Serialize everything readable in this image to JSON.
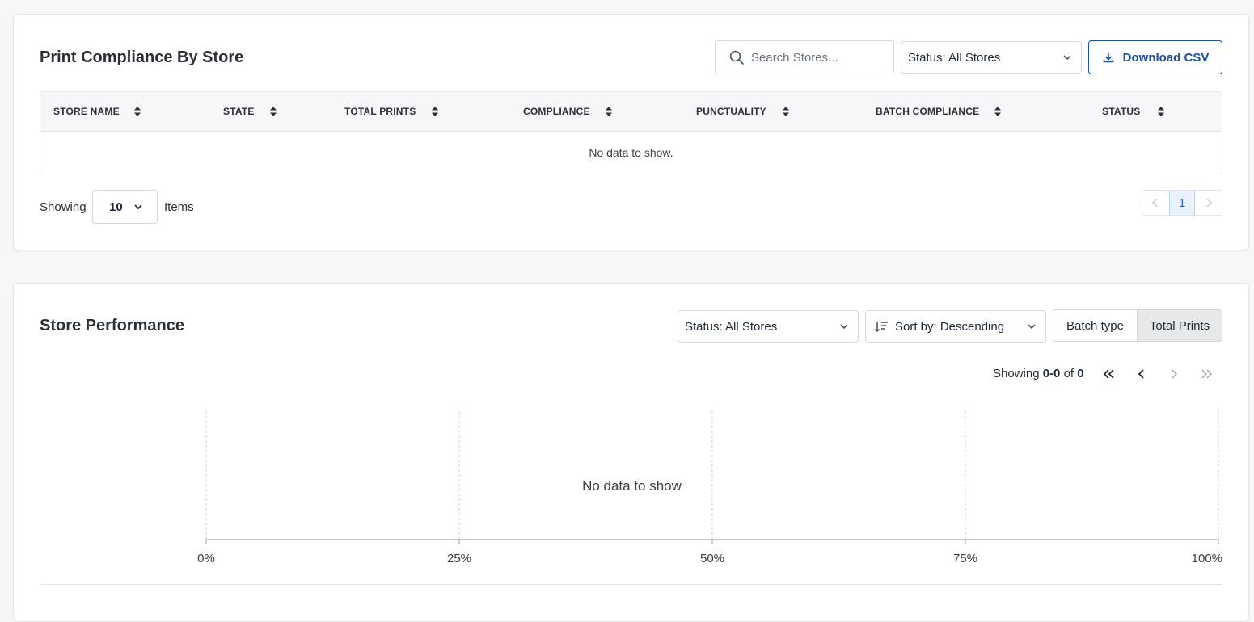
{
  "compliance": {
    "title": "Print Compliance By Store",
    "search_placeholder": "Search Stores...",
    "status_filter": "Status: All Stores",
    "download_label": "Download CSV",
    "columns": [
      "STORE NAME",
      "STATE",
      "TOTAL PRINTS",
      "COMPLIANCE",
      "PUNCTUALITY",
      "BATCH COMPLIANCE",
      "STATUS"
    ],
    "rows": [],
    "empty_text": "No data to show.",
    "showing_label": "Showing",
    "page_size": "10",
    "items_label": "Items",
    "current_page": "1"
  },
  "performance": {
    "title": "Store Performance",
    "status_filter": "Status: All Stores",
    "sort_label": "Sort by: Descending",
    "toggle": [
      "Batch type",
      "Total Prints"
    ],
    "active_toggle": "Total Prints",
    "range_prefix": "Showing",
    "range_value": "0-0",
    "range_of": "of",
    "range_total": "0",
    "empty_text": "No data to show"
  },
  "colors": {
    "primary": "#1d4fa3",
    "page_active": "#2563c9",
    "border": "#d4d7dc"
  },
  "chart_data": {
    "type": "bar",
    "orientation": "horizontal",
    "categories": [],
    "series": [],
    "xlim": [
      0,
      100
    ],
    "x_ticks": [
      "0%",
      "25%",
      "50%",
      "75%",
      "100%"
    ],
    "grid": true,
    "empty_text": "No data to show"
  }
}
